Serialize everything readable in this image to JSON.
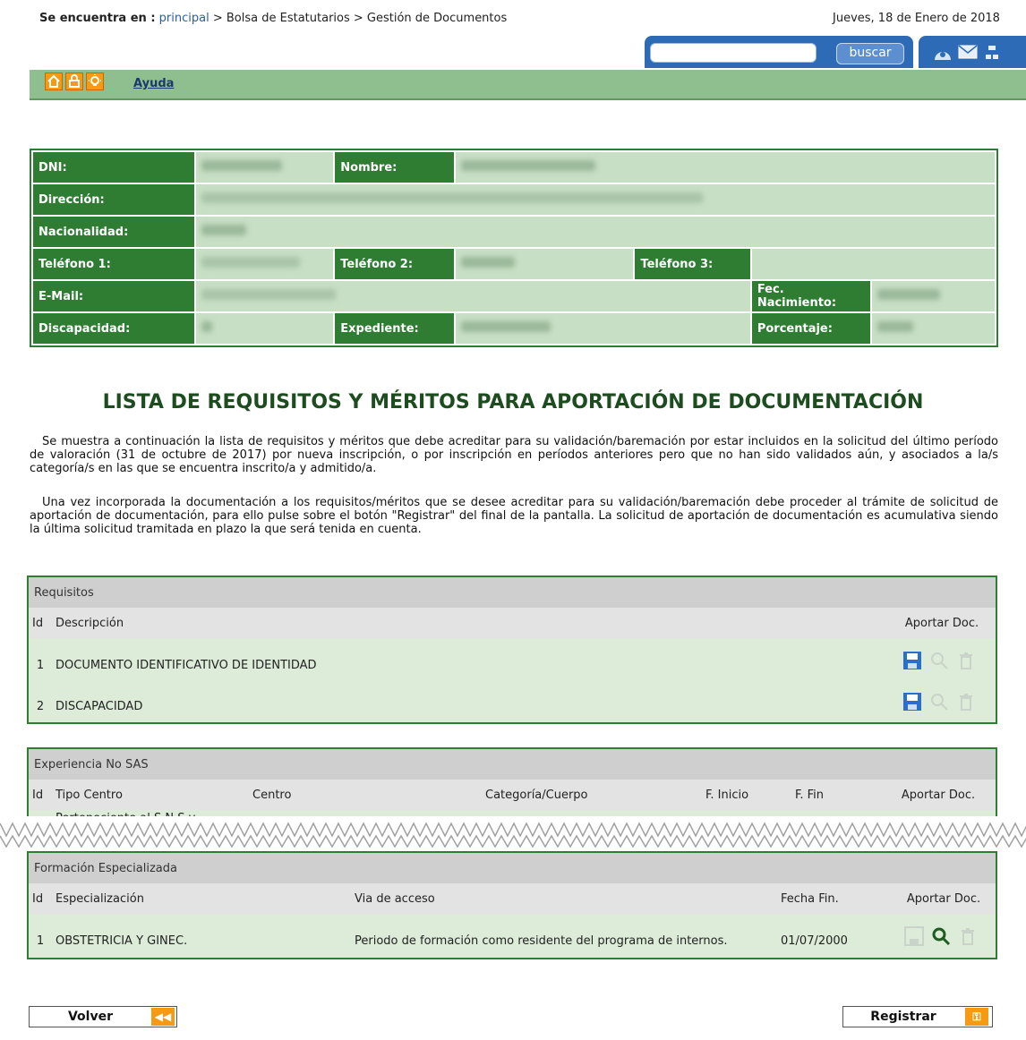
{
  "breadcrumb": {
    "label": "Se encuentra en :",
    "home": "principal",
    "path": "> Bolsa de Estatutarios > Gestión de Documentos"
  },
  "date": "Jueves, 18 de Enero de 2018",
  "search": {
    "button": "buscar",
    "value": ""
  },
  "toolbar": {
    "help": "Ayuda"
  },
  "personal": {
    "dni": "DNI:",
    "nombre": "Nombre:",
    "direccion": "Dirección:",
    "nacionalidad": "Nacionalidad:",
    "telefono1": "Teléfono 1:",
    "telefono2": "Teléfono 2:",
    "telefono3": "Teléfono 3:",
    "email": "E-Mail:",
    "fec_nacimiento": "Fec. Nacimiento:",
    "discapacidad": "Discapacidad:",
    "expediente": "Expediente:",
    "porcentaje": "Porcentaje:"
  },
  "title": "LISTA DE REQUISITOS Y MÉRITOS PARA APORTACIÓN DE DOCUMENTACIÓN",
  "paragraph1": "Se muestra a continuación la lista de requisitos y méritos que debe acreditar para su validación/baremación por estar incluidos en la solicitud del último período de valoración (31 de octubre de 2017) por nueva inscripción, o por inscripción en períodos anteriores pero que no han sido validados aún, y asociados a la/s categoría/s en las que se encuentra inscrito/a y admitido/a.",
  "paragraph2": "Una vez incorporada la documentación a los requisitos/méritos que se desee acreditar para su validación/baremación debe proceder al trámite de solicitud de aportación de documentación, para ello pulse sobre el botón \"Registrar\" del final de la pantalla. La solicitud de aportación de documentación es acumulativa siendo la última solicitud tramitada en plazo la que será tenida en cuenta.",
  "requisitos": {
    "heading": "Requisitos",
    "columns": {
      "id": "Id",
      "descripcion": "Descripción",
      "aportar": "Aportar Doc."
    },
    "rows": [
      {
        "id": "1",
        "descripcion": "DOCUMENTO IDENTIFICATIVO DE IDENTIDAD"
      },
      {
        "id": "2",
        "descripcion": "DISCAPACIDAD"
      }
    ]
  },
  "experiencia": {
    "heading": "Experiencia No SAS",
    "columns": {
      "id": "Id",
      "tipo": "Tipo Centro",
      "centro": "Centro",
      "categoria": "Categoría/Cuerpo",
      "inicio": "F. Inicio",
      "fin": "F. Fin",
      "aportar": "Aportar Doc."
    },
    "partial_row": "Perteneciente al S.N.S y"
  },
  "formacion": {
    "heading": "Formación Especializada",
    "columns": {
      "id": "Id",
      "especializacion": "Especialización",
      "via": "Via de acceso",
      "fecha": "Fecha Fin.",
      "aportar": "Aportar Doc."
    },
    "rows": [
      {
        "id": "1",
        "especializacion": "OBSTETRICIA Y GINEC.",
        "via": "Periodo de formación como residente del programa de internos.",
        "fecha": "01/07/2000"
      }
    ]
  },
  "buttons": {
    "volver": "Volver",
    "registrar": "Registrar"
  }
}
